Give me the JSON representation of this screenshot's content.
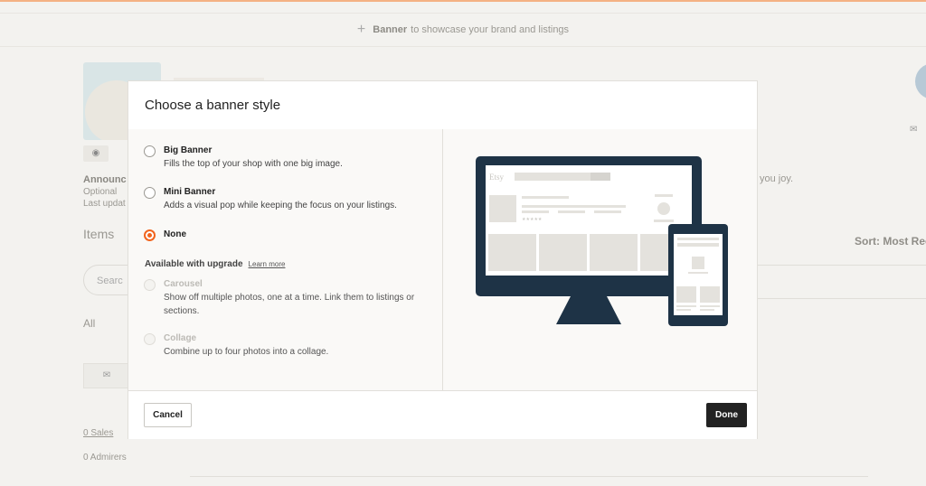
{
  "background": {
    "banner_prompt_bold": "Banner",
    "banner_prompt_rest": "to showcase your brand and listings",
    "announcement_label": "Announc",
    "optional_label": "Optional",
    "last_updated": "Last updat",
    "items_heading": "Items",
    "search_placeholder": "Searc",
    "all_label": "All",
    "sales_link": "0 Sales",
    "admirers": "0 Admirers",
    "joy_text": "you joy.",
    "sort_label": "Sort: Most Rec"
  },
  "modal": {
    "title": "Choose a banner style",
    "options": [
      {
        "title": "Big Banner",
        "description": "Fills the top of your shop with one big image.",
        "selected": false,
        "disabled": false
      },
      {
        "title": "Mini Banner",
        "description": "Adds a visual pop while keeping the focus on your listings.",
        "selected": false,
        "disabled": false
      },
      {
        "title": "None",
        "description": "",
        "selected": true,
        "disabled": false
      }
    ],
    "upgrade_heading": "Available with upgrade",
    "learn_more": "Learn more",
    "upgrade_options": [
      {
        "title": "Carousel",
        "description": "Show off multiple photos, one at a time. Link them to listings or sections.",
        "disabled": true
      },
      {
        "title": "Collage",
        "description": "Combine up to four photos into a collage.",
        "disabled": true
      }
    ],
    "preview_logo": "Etsy",
    "cancel_label": "Cancel",
    "done_label": "Done"
  },
  "colors": {
    "accent": "#f1641e",
    "device_frame": "#1e3346",
    "done_button": "#222222"
  }
}
